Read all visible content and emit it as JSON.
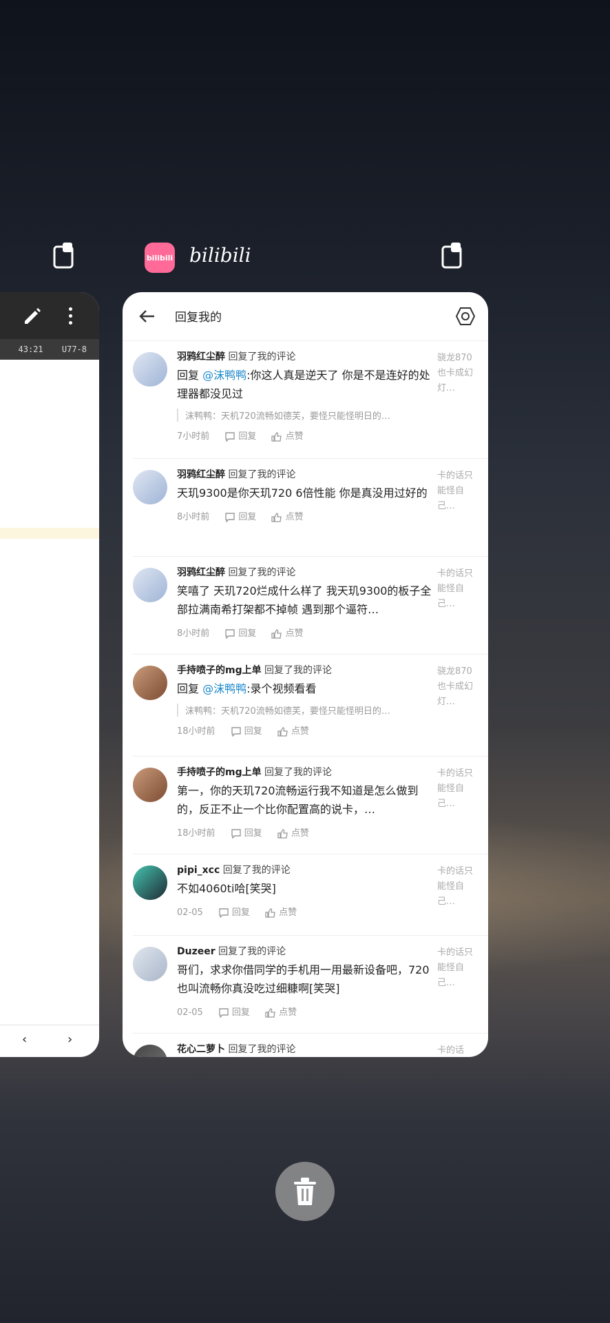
{
  "left_app": {
    "status_left": "43:21",
    "status_right": "U77-8",
    "nav_prev": "‹",
    "nav_next": "›"
  },
  "app": {
    "logo_text": "bilibili",
    "name": "bilibili",
    "accent": "#ff6a98"
  },
  "page": {
    "title": "回复我的"
  },
  "replies": [
    {
      "user": "羽鸦红尘醉",
      "action": "回复了我的评论",
      "prefix": "回复 ",
      "mention": "@沫鸭鸭",
      "text": ":你这人真是逆天了  你是不是连好的处理器都没见过",
      "quote": "沫鸭鸭：天机720流畅如德芙，要怪只能怪明日的…",
      "time": "7小时前",
      "reply": "回复",
      "like": "点赞",
      "preview": "骁龙870也卡成幻灯…"
    },
    {
      "user": "羽鸦红尘醉",
      "action": "回复了我的评论",
      "prefix": "",
      "mention": "",
      "text": "天玑9300是你天玑720  6倍性能 你是真没用过好的",
      "quote": "",
      "time": "8小时前",
      "reply": "回复",
      "like": "点赞",
      "preview": "卡的话只能怪自己…"
    },
    {
      "user": "羽鸦红尘醉",
      "action": "回复了我的评论",
      "prefix": "",
      "mention": "",
      "text": "笑嘻了  天玑720烂成什么样了  我天玑9300的板子全部拉满南希打架都不掉帧 遇到那个逼符…",
      "quote": "",
      "time": "8小时前",
      "reply": "回复",
      "like": "点赞",
      "preview": "卡的话只能怪自己…"
    },
    {
      "user": "手持喷子的mg上单",
      "action": "回复了我的评论",
      "prefix": "回复 ",
      "mention": "@沫鸭鸭",
      "text": ":录个视频看看",
      "quote": "沫鸭鸭：天机720流畅如德芙，要怪只能怪明日的…",
      "time": "18小时前",
      "reply": "回复",
      "like": "点赞",
      "preview": "骁龙870也卡成幻灯…"
    },
    {
      "user": "手持喷子的mg上单",
      "action": "回复了我的评论",
      "prefix": "",
      "mention": "",
      "text": "第一，你的天玑720流畅运行我不知道是怎么做到的，反正不止一个比你配置高的说卡，…",
      "quote": "",
      "time": "18小时前",
      "reply": "回复",
      "like": "点赞",
      "preview": "卡的话只能怪自己…"
    },
    {
      "user": "pipi_xcc",
      "action": "回复了我的评论",
      "prefix": "",
      "mention": "",
      "text": "不如4060ti哈[笑哭]",
      "quote": "",
      "time": "02-05",
      "reply": "回复",
      "like": "点赞",
      "preview": "卡的话只能怪自己…"
    },
    {
      "user": "Duzeer",
      "action": "回复了我的评论",
      "prefix": "",
      "mention": "",
      "text": "哥们，求求你借同学的手机用一用最新设备吧，720也叫流畅你真没吃过细糠啊[笑哭]",
      "quote": "",
      "time": "02-05",
      "reply": "回复",
      "like": "点赞",
      "preview": "卡的话只能怪自己…"
    },
    {
      "user": "花心二萝卜",
      "action": "回复了我的评论",
      "prefix": "",
      "mention": "",
      "text": "",
      "quote": "",
      "time": "",
      "reply": "",
      "like": "",
      "preview": "卡的话"
    }
  ]
}
